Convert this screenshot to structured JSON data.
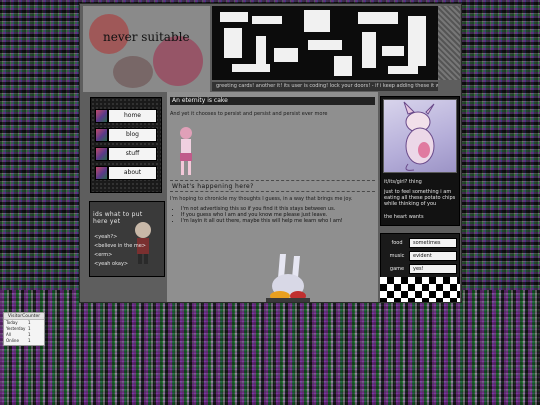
{
  "header": {
    "title": "never suitable",
    "subtitle": "",
    "marquee": "greeting cards! another it! its user is coding! lock your doors! - if i keep adding these it w"
  },
  "nav": {
    "items": [
      {
        "label": "home"
      },
      {
        "label": "blog"
      },
      {
        "label": "stuff"
      },
      {
        "label": "about"
      }
    ]
  },
  "todo": {
    "title": "ids what to put here yet",
    "items": [
      "<yeah?>",
      "<believe in the me>",
      "<erm>",
      "<yeah okay>"
    ],
    "note": ""
  },
  "post": {
    "title": "An eternity is cake",
    "body": "And yet it chooses to persist and persist and persist ever more"
  },
  "happening": {
    "title": "What's happening here?",
    "intro": "I'm hoping to chronicle my thoughts I guess, in a way that brings me joy.",
    "bullets": [
      "I'm not advertising this so if you find it this stays between us.",
      "If you guess who I am and you know me please just leave.",
      "I'm layin it all out there, maybe this will help me learn who I am!"
    ]
  },
  "sidebar_right": {
    "caption": "it/its/girl? thing",
    "blurb": "just to feel something i am eating all these potato chips while thinking of you",
    "heart": "the heart wants"
  },
  "likes": [
    {
      "category": "food",
      "value": "sometimes"
    },
    {
      "category": "music",
      "value": "evident"
    },
    {
      "category": "game",
      "value": "yes!"
    }
  ],
  "counter": {
    "title": "VisitorCounter",
    "rows": [
      {
        "label": "Today",
        "value": "1"
      },
      {
        "label": "Yesterday",
        "value": "1"
      },
      {
        "label": "All",
        "value": "1"
      },
      {
        "label": "Online",
        "value": "1"
      }
    ]
  },
  "colors": {
    "frame": "#5e5e5e",
    "content": "#8f8f8f",
    "dark_panel": "#121212",
    "title_bar": "#222222"
  }
}
